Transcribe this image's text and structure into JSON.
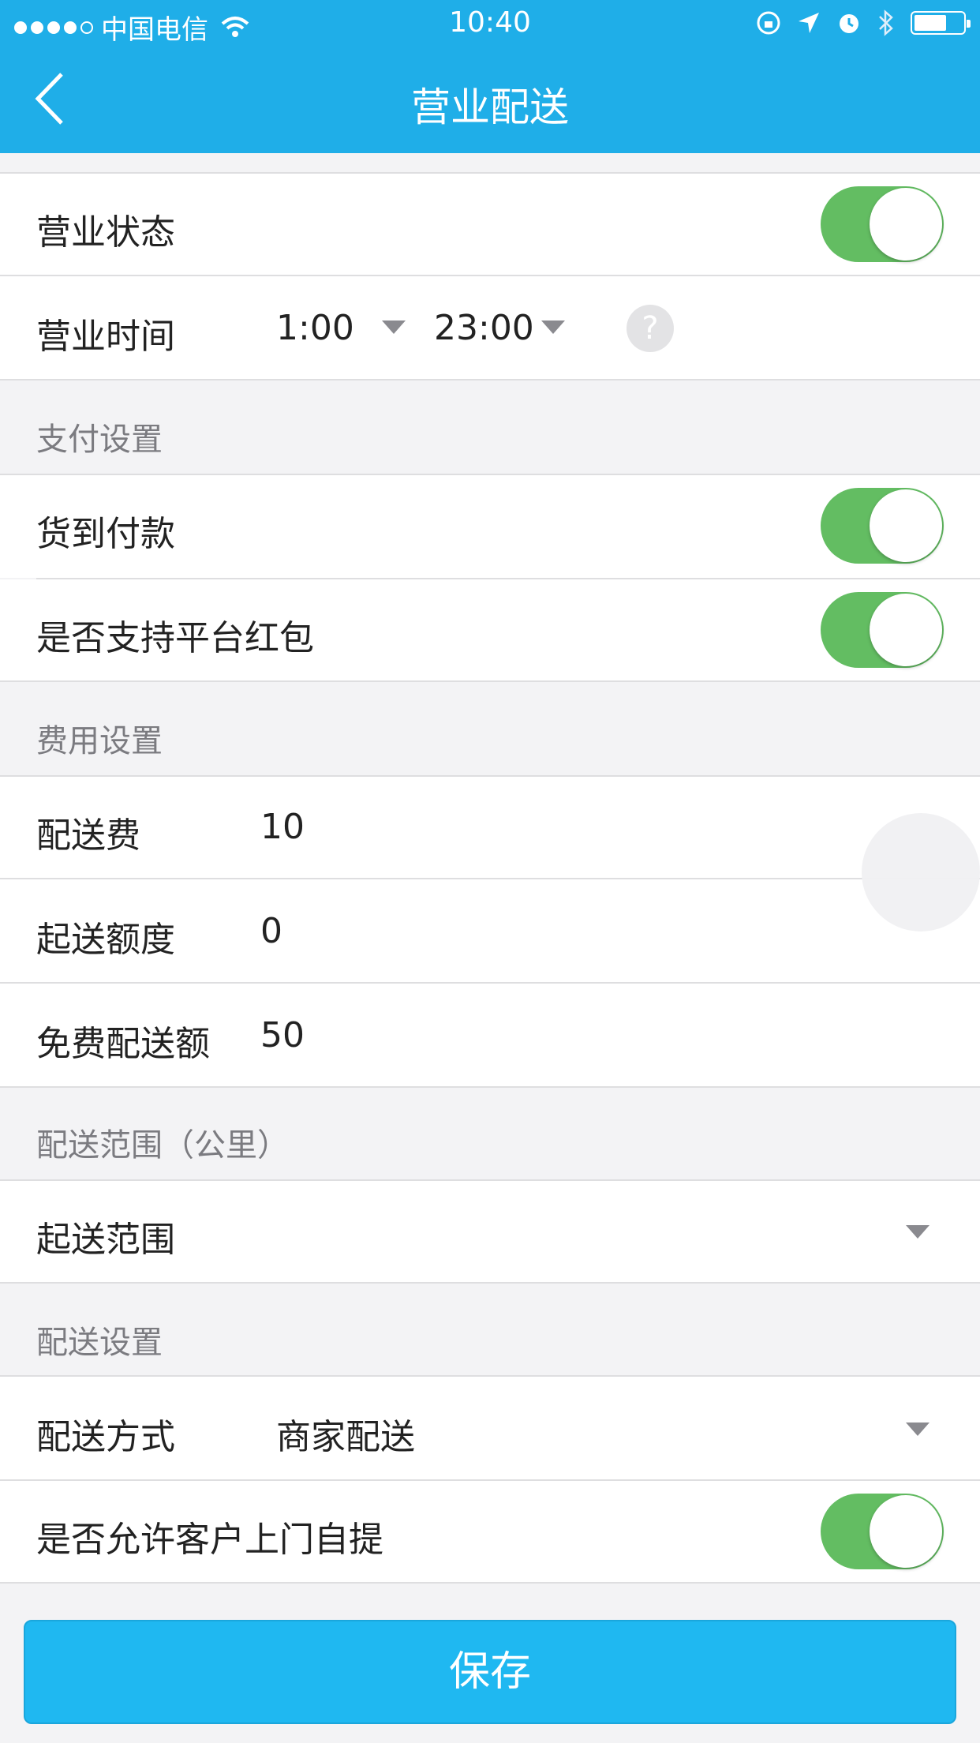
{
  "status_bar": {
    "carrier": "中国电信",
    "time": "10:40"
  },
  "header": {
    "title": "营业配送"
  },
  "business": {
    "status_label": "营业状态",
    "status_on": true,
    "hours_label": "营业时间",
    "open_time": "1:00",
    "close_time": "23:00",
    "help_symbol": "?"
  },
  "payment": {
    "section_title": "支付设置",
    "cod_label": "货到付款",
    "cod_on": true,
    "platform_redpacket_label": "是否支持平台红包",
    "platform_redpacket_on": true
  },
  "fees": {
    "section_title": "费用设置",
    "delivery_fee_label": "配送费",
    "delivery_fee_value": "10",
    "min_order_label": "起送额度",
    "min_order_value": "0",
    "free_delivery_label": "免费配送额",
    "free_delivery_value": "50"
  },
  "range": {
    "section_title": "配送范围（公里）",
    "start_range_label": "起送范围"
  },
  "delivery": {
    "section_title": "配送设置",
    "method_label": "配送方式",
    "method_value": "商家配送",
    "self_pickup_label": "是否允许客户上门自提",
    "self_pickup_on": true
  },
  "actions": {
    "save_label": "保存"
  },
  "colors": {
    "header_bg": "#1faee8",
    "toggle_on": "#63bd62",
    "save_bg": "#1fb8f1"
  }
}
